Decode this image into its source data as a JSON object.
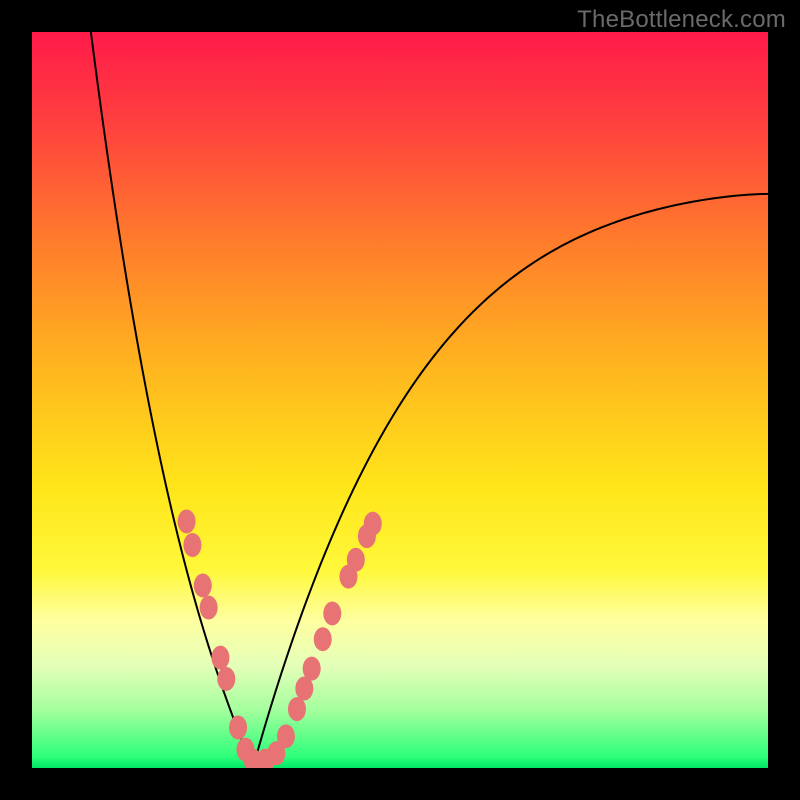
{
  "watermark": "TheBottleneck.com",
  "colors": {
    "frame": "#000000",
    "curve": "#000000",
    "dot_fill": "#e77374",
    "dot_stroke": "#d65a5b",
    "gradient_stops": [
      {
        "offset": 0.0,
        "color": "#ff1b4a"
      },
      {
        "offset": 0.12,
        "color": "#ff3f3f"
      },
      {
        "offset": 0.28,
        "color": "#ff7a2c"
      },
      {
        "offset": 0.45,
        "color": "#ffb41f"
      },
      {
        "offset": 0.62,
        "color": "#ffe61a"
      },
      {
        "offset": 0.73,
        "color": "#fff83a"
      },
      {
        "offset": 0.8,
        "color": "#feffa0"
      },
      {
        "offset": 0.86,
        "color": "#e5ffb8"
      },
      {
        "offset": 0.92,
        "color": "#a6ff9e"
      },
      {
        "offset": 0.985,
        "color": "#2dff7a"
      },
      {
        "offset": 1.0,
        "color": "#00e765"
      }
    ]
  },
  "chart_data": {
    "type": "line",
    "title": "",
    "xlabel": "",
    "ylabel": "",
    "xlim": [
      0,
      1
    ],
    "ylim": [
      0,
      1
    ],
    "curve": {
      "minimum_x": 0.3,
      "left_start": {
        "x": 0.08,
        "y": 1.0
      },
      "right_end": {
        "x": 1.0,
        "y": 0.78
      }
    },
    "series": [
      {
        "name": "highlighted-points",
        "points": [
          {
            "x": 0.21,
            "y": 0.335
          },
          {
            "x": 0.218,
            "y": 0.303
          },
          {
            "x": 0.232,
            "y": 0.248
          },
          {
            "x": 0.24,
            "y": 0.218
          },
          {
            "x": 0.256,
            "y": 0.15
          },
          {
            "x": 0.264,
            "y": 0.121
          },
          {
            "x": 0.28,
            "y": 0.055
          },
          {
            "x": 0.29,
            "y": 0.025
          },
          {
            "x": 0.3,
            "y": 0.01
          },
          {
            "x": 0.317,
            "y": 0.01
          },
          {
            "x": 0.332,
            "y": 0.02
          },
          {
            "x": 0.345,
            "y": 0.043
          },
          {
            "x": 0.36,
            "y": 0.08
          },
          {
            "x": 0.37,
            "y": 0.108
          },
          {
            "x": 0.38,
            "y": 0.135
          },
          {
            "x": 0.395,
            "y": 0.175
          },
          {
            "x": 0.408,
            "y": 0.21
          },
          {
            "x": 0.43,
            "y": 0.26
          },
          {
            "x": 0.44,
            "y": 0.283
          },
          {
            "x": 0.455,
            "y": 0.315
          },
          {
            "x": 0.463,
            "y": 0.332
          }
        ]
      }
    ]
  }
}
